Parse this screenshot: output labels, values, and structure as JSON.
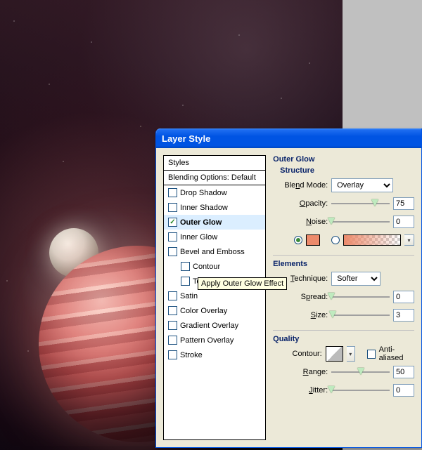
{
  "dialog": {
    "title": "Layer Style"
  },
  "styles_panel": {
    "header": "Styles",
    "blending_options": "Blending Options: Default",
    "items": [
      {
        "label": "Drop Shadow",
        "checked": false,
        "selected": false,
        "indent": false
      },
      {
        "label": "Inner Shadow",
        "checked": false,
        "selected": false,
        "indent": false
      },
      {
        "label": "Outer Glow",
        "checked": true,
        "selected": true,
        "indent": false
      },
      {
        "label": "Inner Glow",
        "checked": false,
        "selected": false,
        "indent": false
      },
      {
        "label": "Bevel and Emboss",
        "checked": false,
        "selected": false,
        "indent": false
      },
      {
        "label": "Contour",
        "checked": false,
        "selected": false,
        "indent": true
      },
      {
        "label": "Texture",
        "checked": false,
        "selected": false,
        "indent": true
      },
      {
        "label": "Satin",
        "checked": false,
        "selected": false,
        "indent": false
      },
      {
        "label": "Color Overlay",
        "checked": false,
        "selected": false,
        "indent": false
      },
      {
        "label": "Gradient Overlay",
        "checked": false,
        "selected": false,
        "indent": false
      },
      {
        "label": "Pattern Overlay",
        "checked": false,
        "selected": false,
        "indent": false
      },
      {
        "label": "Stroke",
        "checked": false,
        "selected": false,
        "indent": false
      }
    ]
  },
  "tooltip": "Apply Outer Glow Effect",
  "outer_glow": {
    "title": "Outer Glow",
    "structure": {
      "title": "Structure",
      "blend_mode_label": "Blend Mode:",
      "blend_mode_value": "Overlay",
      "opacity_label": "Opacity:",
      "opacity_value": "75",
      "opacity_slider_pct": 75,
      "noise_label": "Noise:",
      "noise_value": "0",
      "noise_slider_pct": 0,
      "color_mode": "solid",
      "solid_color": "#ec8a6b"
    },
    "elements": {
      "title": "Elements",
      "technique_label": "Technique:",
      "technique_value": "Softer",
      "spread_label": "Spread:",
      "spread_value": "0",
      "spread_slider_pct": 0,
      "size_label": "Size:",
      "size_value": "3",
      "size_slider_pct": 2
    },
    "quality": {
      "title": "Quality",
      "contour_label": "Contour:",
      "anti_aliased_label": "Anti-aliased",
      "anti_aliased_checked": false,
      "range_label": "Range:",
      "range_value": "50",
      "range_slider_pct": 50,
      "jitter_label": "Jitter:",
      "jitter_value": "0",
      "jitter_slider_pct": 0
    }
  }
}
